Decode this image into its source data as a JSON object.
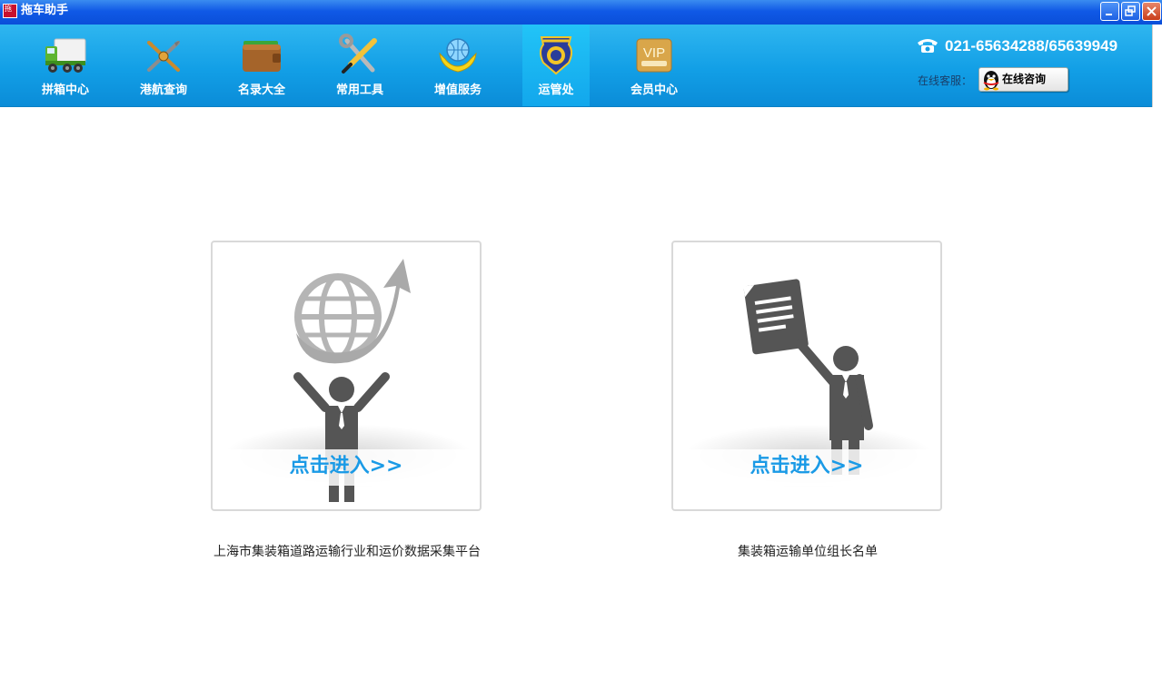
{
  "window": {
    "title": "拖车助手"
  },
  "nav": {
    "items": [
      {
        "label": "拼箱中心",
        "icon": "truck-icon"
      },
      {
        "label": "港航查询",
        "icon": "anchor-compass-icon"
      },
      {
        "label": "名录大全",
        "icon": "wallet-icon"
      },
      {
        "label": "常用工具",
        "icon": "tools-icon"
      },
      {
        "label": "增值服务",
        "icon": "globe-hands-icon"
      },
      {
        "label": "运管处",
        "icon": "badge-icon",
        "active": true
      },
      {
        "label": "会员中心",
        "icon": "vip-icon"
      }
    ],
    "phone": "021-65634288/65639949",
    "customer_service_label": "在线客服：",
    "online_button_label": "在线咨询"
  },
  "cards": [
    {
      "cta": "点击进入>>",
      "caption": "上海市集装箱道路运输行业和运价数据采集平台",
      "art": "person-globe-arrow-icon"
    },
    {
      "cta": "点击进入>>",
      "caption": "集装箱运输单位组长名单",
      "art": "person-document-icon"
    }
  ],
  "colors": {
    "nav_bg": "#129fe6",
    "cta": "#1a9ae6",
    "title_bar": "#1059e6"
  }
}
